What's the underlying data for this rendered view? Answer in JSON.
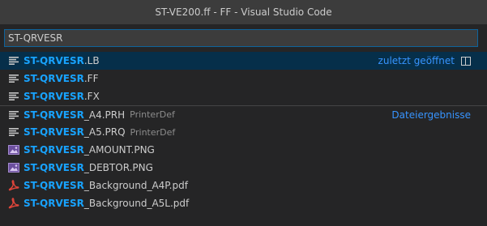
{
  "window": {
    "title": "ST-VE200.ff - FF - Visual Studio Code"
  },
  "search": {
    "value": "ST-QRVESR"
  },
  "labels": {
    "recent": "zuletzt geöffnet",
    "file_results": "Dateiergebnisse"
  },
  "items": [
    {
      "match": "ST-QRVESR",
      "rest": ".LB",
      "desc": "",
      "icon": "lines-icon"
    },
    {
      "match": "ST-QRVESR",
      "rest": ".FF",
      "desc": "",
      "icon": "lines-icon"
    },
    {
      "match": "ST-QRVESR",
      "rest": ".FX",
      "desc": "",
      "icon": "lines-icon"
    },
    {
      "match": "ST-QRVESR",
      "rest": "_A4.PRH",
      "desc": "PrinterDef",
      "icon": "lines-icon"
    },
    {
      "match": "ST-QRVESR",
      "rest": "_A5.PRQ",
      "desc": "PrinterDef",
      "icon": "lines-icon"
    },
    {
      "match": "ST-QRVESR",
      "rest": "_AMOUNT.PNG",
      "desc": "",
      "icon": "image-icon"
    },
    {
      "match": "ST-QRVESR",
      "rest": "_DEBTOR.PNG",
      "desc": "",
      "icon": "image-icon"
    },
    {
      "match": "ST-QRVESR",
      "rest": "_Background_A4P.pdf",
      "desc": "",
      "icon": "pdf-icon"
    },
    {
      "match": "ST-QRVESR",
      "rest": "_Background_A5L.pdf",
      "desc": "",
      "icon": "pdf-icon"
    }
  ]
}
